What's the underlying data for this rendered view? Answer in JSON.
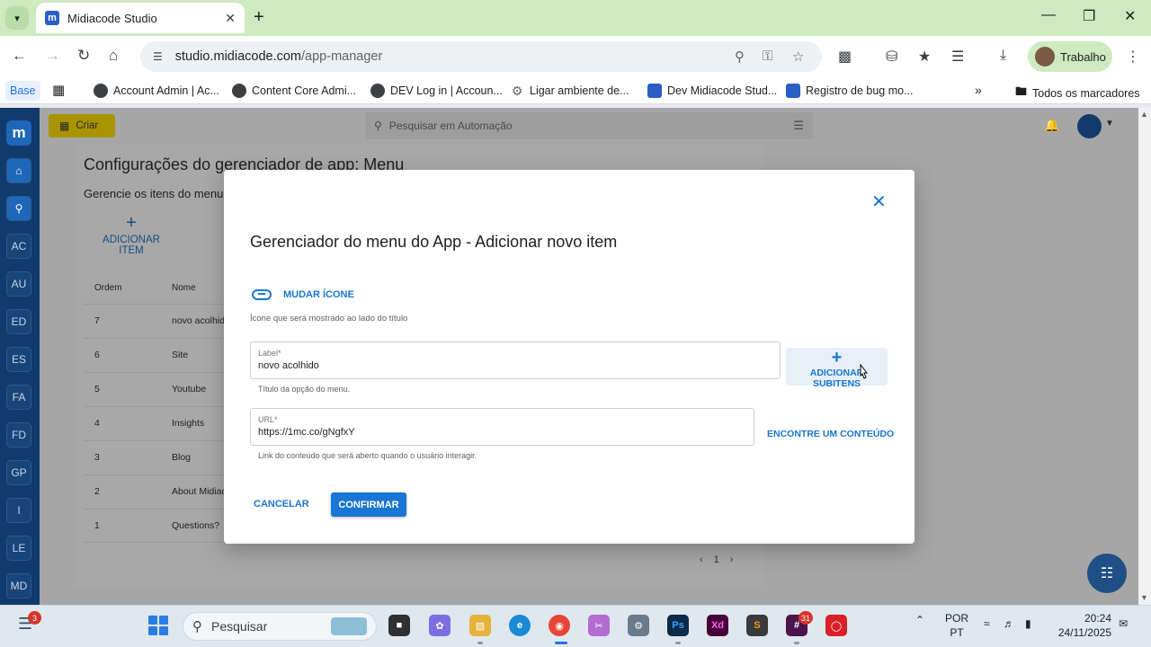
{
  "browser": {
    "tab_title": "Midiacode Studio",
    "url_domain": "studio.midiacode.com",
    "url_path": "/app-manager",
    "profile_name": "Trabalho",
    "bookmarks": [
      "Account Admin | Ac...",
      "Content Core Admi...",
      "DEV Log in | Accoun...",
      "Ligar ambiente de...",
      "Dev Midiacode Stud...",
      "Registro de bug mo..."
    ],
    "bookmark_base": "Base",
    "all_bookmarks": "Todos os marcadores"
  },
  "app": {
    "create_label": "Criar",
    "search_placeholder": "Pesquisar em Automação",
    "sidebar": [
      "AC",
      "AU",
      "ED",
      "ES",
      "FA",
      "FD",
      "GP",
      "I",
      "LE",
      "MD"
    ],
    "page_title": "Configurações do gerenciador de app: Menu",
    "page_subtitle": "Gerencie os itens do menu",
    "add_item_label": "ADICIONAR ITEM",
    "table": {
      "headers": [
        "Ordem",
        "Nome"
      ],
      "rows": [
        {
          "order": "7",
          "name": "novo acolhido"
        },
        {
          "order": "6",
          "name": "Site"
        },
        {
          "order": "5",
          "name": "Youtube"
        },
        {
          "order": "4",
          "name": "Insights"
        },
        {
          "order": "3",
          "name": "Blog"
        },
        {
          "order": "2",
          "name": "About Midiac"
        },
        {
          "order": "1",
          "name": "Questions?"
        }
      ]
    },
    "page_number": "1"
  },
  "modal": {
    "title": "Gerenciador do menu do App - Adicionar novo item",
    "change_icon_label": "MUDAR ÍCONE",
    "icon_help": "Ícone que será mostrado ao lado do título",
    "label_field": {
      "label": "Label*",
      "value": "novo acolhido",
      "help": "Título da opção do menu."
    },
    "add_subitems_label": "ADICIONAR SUBITENS",
    "url_field": {
      "label": "URL*",
      "value": "https://1mc.co/gNgfxY",
      "help": "Link do conteúdo que será aberto quando o usuário interagir."
    },
    "find_content_label": "ENCONTRE UM CONTEÚDO",
    "cancel_label": "CANCELAR",
    "confirm_label": "CONFIRMAR"
  },
  "taskbar": {
    "search_placeholder": "Pesquisar",
    "notification_count": "3",
    "app_badge": "31",
    "lang_line1": "POR",
    "lang_line2": "PT",
    "time": "20:24",
    "date": "24/11/2025"
  },
  "colors": {
    "accent": "#1976d2",
    "sidebar": "#123b6d",
    "create_button": "#a89400",
    "tabbar": "#cdeac0"
  }
}
